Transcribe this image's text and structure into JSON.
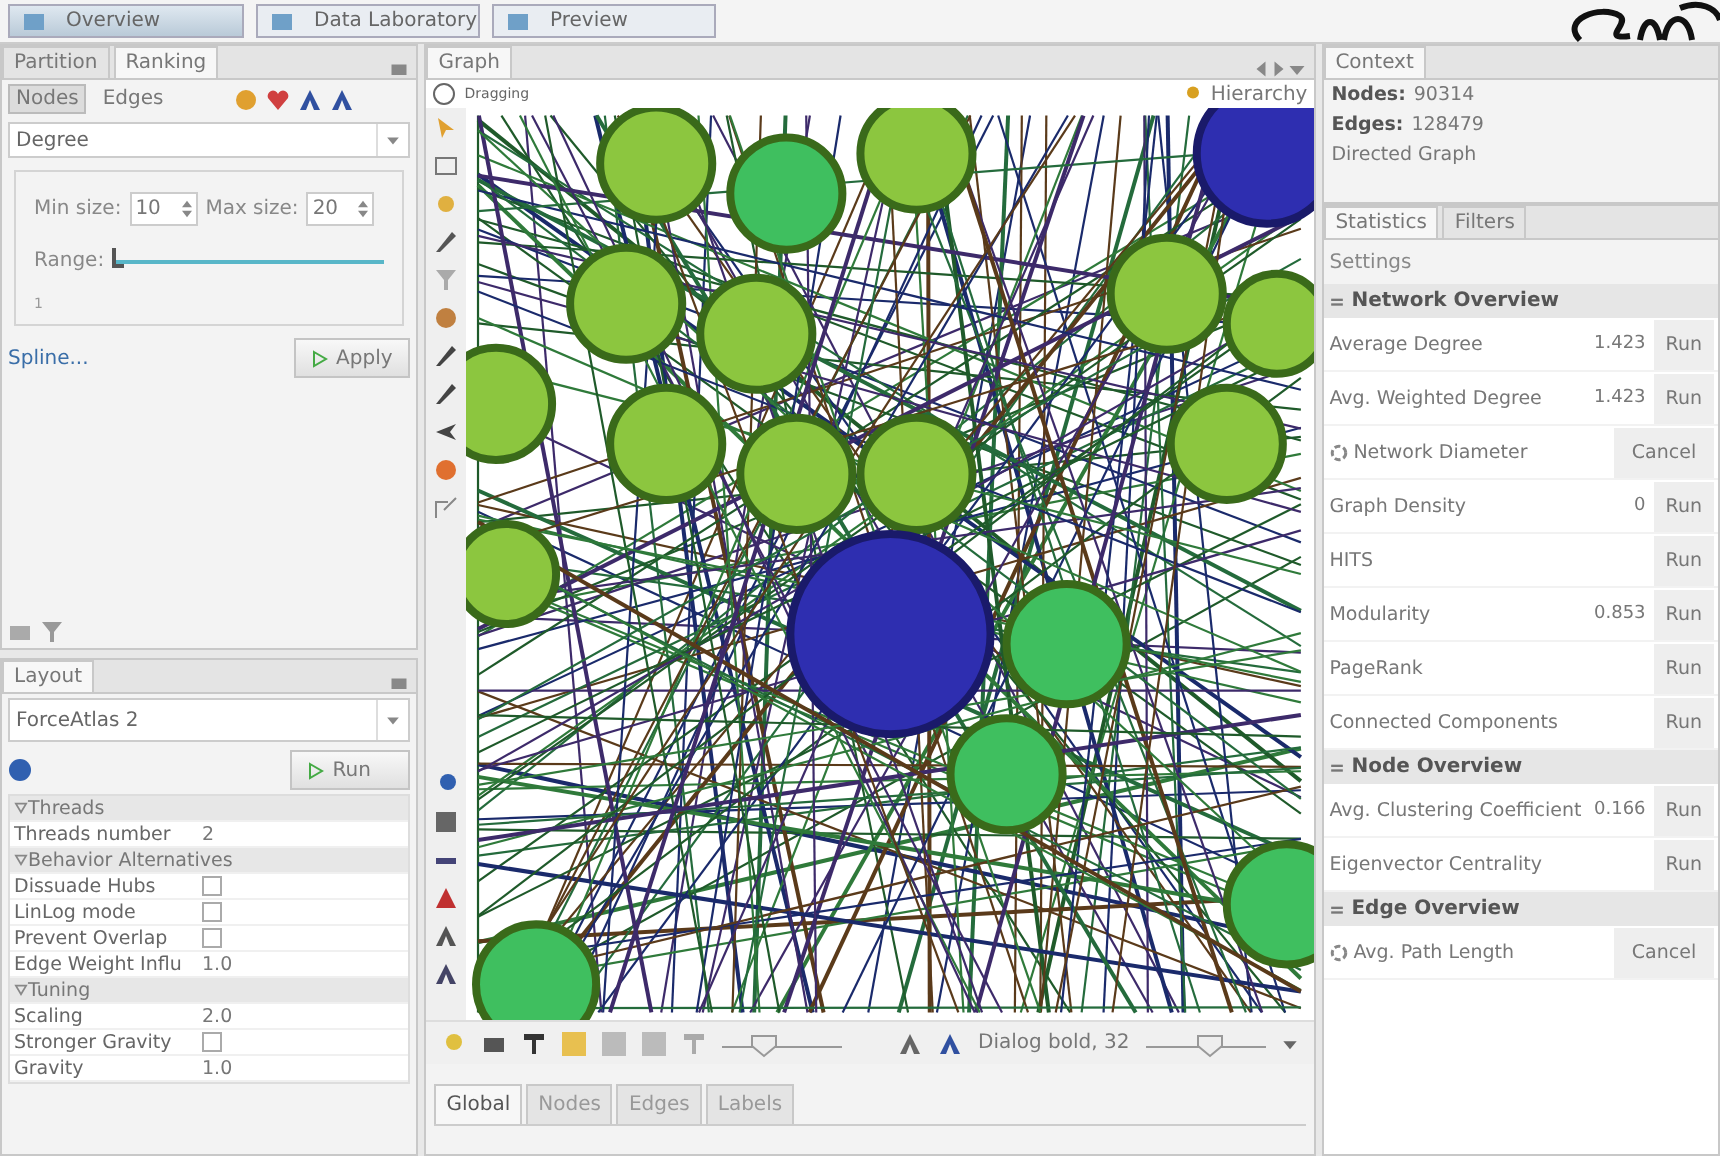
{
  "workspace_tabs": [
    {
      "label": "Overview",
      "selected": true
    },
    {
      "label": "Data Laboratory",
      "selected": false
    },
    {
      "label": "Preview",
      "selected": false
    }
  ],
  "ranking_panel": {
    "tabs": [
      {
        "label": "Partition",
        "selected": false
      },
      {
        "label": "Ranking",
        "selected": true
      }
    ],
    "subtabs": [
      {
        "label": "Nodes",
        "selected": true
      },
      {
        "label": "Edges",
        "selected": false
      }
    ],
    "attribute": "Degree",
    "min_size_label": "Min size:",
    "min_size": "10",
    "max_size_label": "Max size:",
    "max_size": "20",
    "range_label": "Range:",
    "range_slider": {
      "level": 0.0
    },
    "range_min": "1",
    "spline": "Spline...",
    "apply": "Apply"
  },
  "layout_panel": {
    "title": "Layout",
    "algorithm": "ForceAtlas 2",
    "run": "Run",
    "properties": [
      {
        "kind": "group",
        "label": "Threads"
      },
      {
        "kind": "value",
        "label": "Threads number",
        "value": "2"
      },
      {
        "kind": "group",
        "label": "Behavior Alternatives"
      },
      {
        "kind": "check",
        "label": "Dissuade Hubs",
        "checked": false
      },
      {
        "kind": "check",
        "label": "LinLog mode",
        "checked": false
      },
      {
        "kind": "check",
        "label": "Prevent Overlap",
        "checked": false
      },
      {
        "kind": "value",
        "label": "Edge Weight Influ",
        "value": "1.0"
      },
      {
        "kind": "group",
        "label": "Tuning"
      },
      {
        "kind": "value",
        "label": "Scaling",
        "value": "2.0"
      },
      {
        "kind": "check",
        "label": "Stronger Gravity",
        "checked": false
      },
      {
        "kind": "value",
        "label": "Gravity",
        "value": "1.0"
      }
    ]
  },
  "graph_panel": {
    "tab": "Graph",
    "mode": "Dragging",
    "hierarchy": "Hierarchy",
    "node_size_slider": {
      "level": 0.3
    },
    "label_font": "Dialog bold, 32",
    "label_size_slider": {
      "level": 0.55
    },
    "bottom_tabs": [
      {
        "label": "Global",
        "selected": true
      },
      {
        "label": "Nodes",
        "selected": false
      },
      {
        "label": "Edges",
        "selected": false
      },
      {
        "label": "Labels",
        "selected": false
      }
    ]
  },
  "context": {
    "title": "Context",
    "nodes_label": "Nodes:",
    "nodes": "90314",
    "edges_label": "Edges:",
    "edges": "128479",
    "graph_type": "Directed Graph"
  },
  "statistics": {
    "tabs": [
      {
        "label": "Statistics",
        "selected": true
      },
      {
        "label": "Filters",
        "selected": false
      }
    ],
    "settings": "Settings",
    "sections": [
      {
        "title": "Network Overview",
        "rows": [
          {
            "name": "Average Degree",
            "value": "1.423",
            "action": "Run",
            "running": false
          },
          {
            "name": "Avg. Weighted Degree",
            "value": "1.423",
            "action": "Run",
            "running": false
          },
          {
            "name": "Network Diameter",
            "action": "Cancel",
            "running": true
          },
          {
            "name": "Graph Density",
            "value": "0",
            "action": "Run",
            "running": false
          },
          {
            "name": "HITS",
            "action": "Run",
            "running": false
          },
          {
            "name": "Modularity",
            "value": "0.853",
            "action": "Run",
            "running": false
          },
          {
            "name": "PageRank",
            "action": "Run",
            "running": false
          },
          {
            "name": "Connected Components",
            "action": "Run",
            "running": false
          }
        ]
      },
      {
        "title": "Node Overview",
        "rows": [
          {
            "name": "Avg. Clustering Coefficient",
            "value": "0.166",
            "action": "Run",
            "running": false
          },
          {
            "name": "Eigenvector Centrality",
            "action": "Run",
            "running": false
          }
        ]
      },
      {
        "title": "Edge Overview",
        "rows": [
          {
            "name": "Avg. Path Length",
            "action": "Cancel",
            "running": true
          }
        ]
      }
    ]
  }
}
